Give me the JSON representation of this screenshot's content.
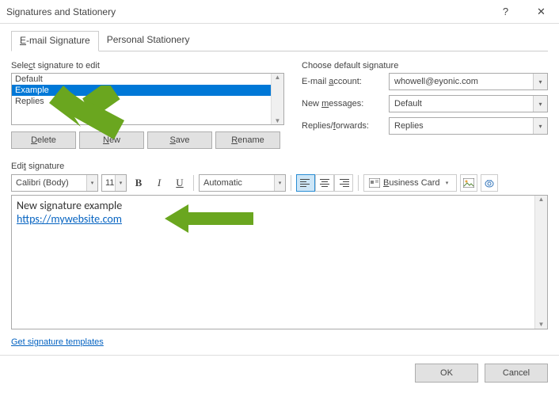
{
  "title": "Signatures and Stationery",
  "tabs": {
    "email": "E-mail Signature",
    "stationery": "Personal Stationery"
  },
  "select_label": "Select signature to edit",
  "signatures": [
    "Default",
    "Example",
    "Replies"
  ],
  "buttons": {
    "delete": "Delete",
    "new": "New",
    "save": "Save",
    "rename": "Rename"
  },
  "defaults_label": "Choose default signature",
  "fields": {
    "account_label": "E-mail account:",
    "account_value": "whowell@eyonic.com",
    "newmsg_label": "New messages:",
    "newmsg_value": "Default",
    "replies_label": "Replies/forwards:",
    "replies_value": "Replies"
  },
  "edit_label": "Edit signature",
  "toolbar": {
    "font": "Calibri (Body)",
    "size": "11",
    "bold": "B",
    "italic": "I",
    "underline": "U",
    "auto": "Automatic",
    "businesscard": "Business Card"
  },
  "editor": {
    "line1": "New signature example",
    "link": "https://mywebsite.com"
  },
  "templates_link": "Get signature templates",
  "footer": {
    "ok": "OK",
    "cancel": "Cancel"
  }
}
